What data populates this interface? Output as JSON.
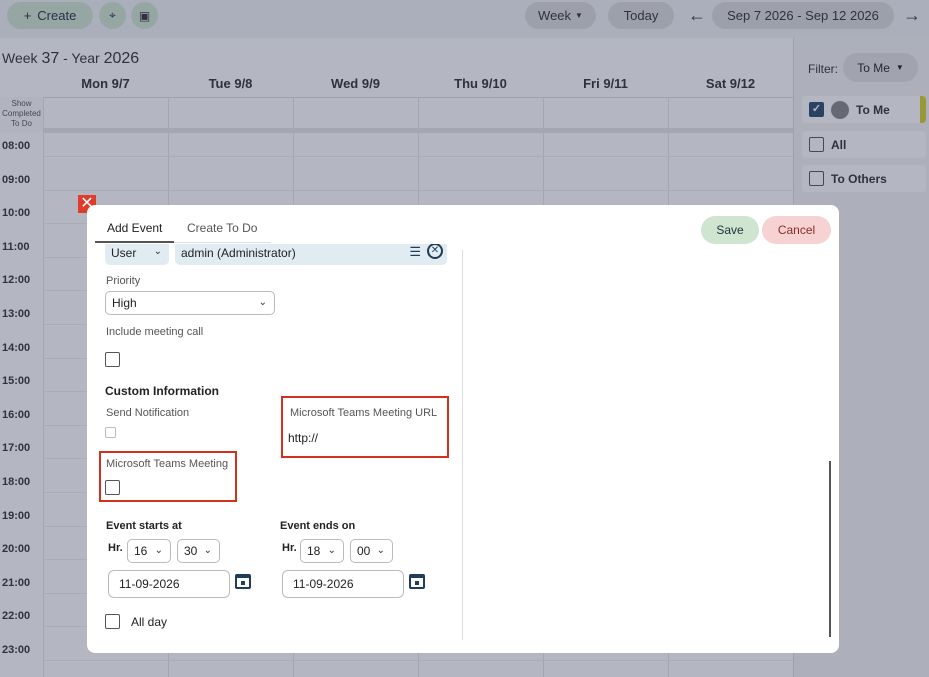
{
  "toolbar": {
    "create_label": "Create",
    "view_label": "Week",
    "today_label": "Today",
    "date_range": "Sep 7 2026 - Sep 12 2026"
  },
  "calendar": {
    "week_prefix": "Week",
    "week_number": "37",
    "year_prefix": "- Year",
    "year": "2026",
    "days": [
      "Mon 9/7",
      "Tue 9/8",
      "Wed 9/9",
      "Thu 9/10",
      "Fri 9/11",
      "Sat 9/12"
    ],
    "show_completed": "Show Completed To Do",
    "hours": [
      "08:00",
      "09:00",
      "10:00",
      "11:00",
      "12:00",
      "13:00",
      "14:00",
      "15:00",
      "16:00",
      "17:00",
      "18:00",
      "19:00",
      "20:00",
      "21:00",
      "22:00",
      "23:00"
    ]
  },
  "sidebar": {
    "filter_label": "Filter:",
    "filter_value": "To Me",
    "items": [
      {
        "label": "To Me",
        "checked": true
      },
      {
        "label": "All",
        "checked": false
      },
      {
        "label": "To Others",
        "checked": false
      }
    ]
  },
  "modal": {
    "tabs": [
      "Add Event",
      "Create To Do"
    ],
    "save_label": "Save",
    "cancel_label": "Cancel",
    "assign_type": "User",
    "assign_value": "admin (Administrator)",
    "priority_label": "Priority",
    "priority_value": "High",
    "meeting_call_label": "Include meeting call",
    "custom_info_heading": "Custom Information",
    "send_notification_label": "Send Notification",
    "teams_url_label": "Microsoft Teams Meeting URL",
    "teams_url_value": "http://",
    "teams_meeting_label": "Microsoft Teams Meeting",
    "start_heading": "Event starts at",
    "end_heading": "Event ends on",
    "hr_label": "Hr.",
    "start_hour": "16",
    "start_min": "30",
    "end_hour": "18",
    "end_min": "00",
    "start_date": "11-09-2026",
    "end_date": "11-09-2026",
    "all_day_label": "All day"
  }
}
